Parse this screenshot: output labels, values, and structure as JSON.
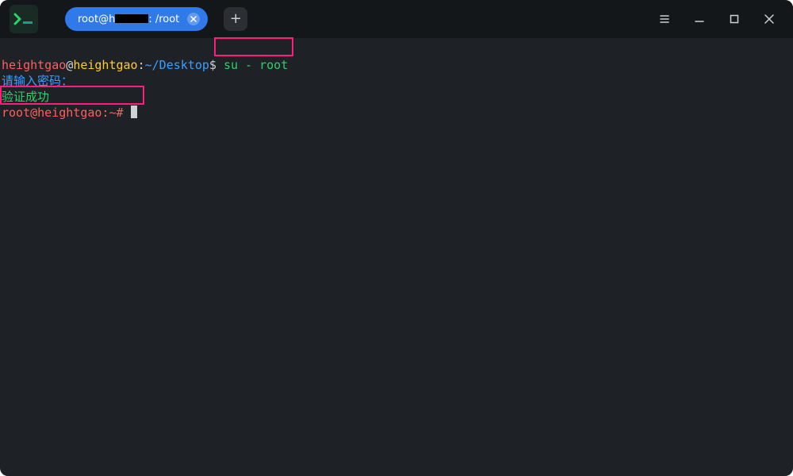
{
  "titlebar": {
    "tab": {
      "label_before_redact": "root@h",
      "label_after_redact": ": /root"
    },
    "newtab_glyph": "+"
  },
  "colors": {
    "tab_active": "#2f79e8",
    "bg": "#1e2126",
    "titlebar_bg": "#14171a",
    "highlight_border": "#ff1e7b",
    "ansi_user": "#ff5f5f",
    "ansi_host": "#ffcc33",
    "ansi_path": "#3aa0ff",
    "ansi_cmd": "#2cd26a"
  },
  "terminal": {
    "prompt1_user": "heightgao",
    "prompt1_at": "@",
    "prompt1_host": "heightgao",
    "prompt1_sep": ":",
    "prompt1_path": "~/Desktop",
    "prompt1_sym": "$ ",
    "prompt1_cmd": "su - root",
    "line2": "请输入密码：",
    "line3": "验证成功",
    "prompt2": "root@heightgao:~# "
  }
}
